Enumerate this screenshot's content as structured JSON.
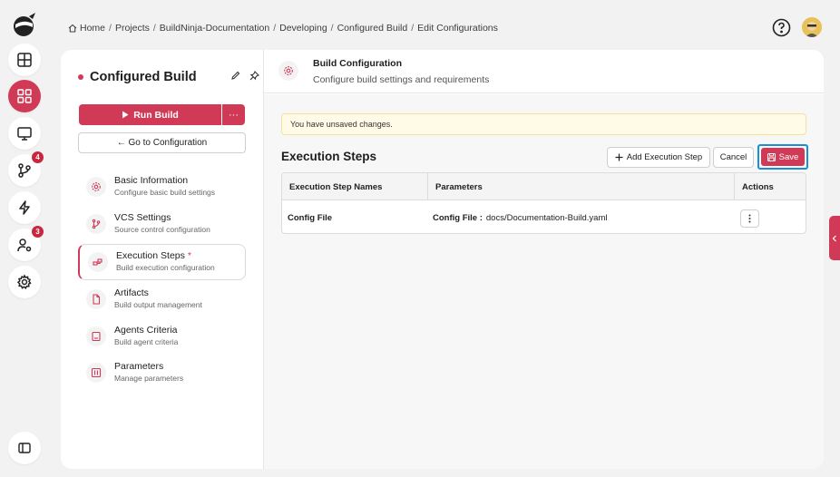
{
  "breadcrumb": [
    "Home",
    "Projects",
    "BuildNinja-Documentation",
    "Developing",
    "Configured Build",
    "Edit Configurations"
  ],
  "rail": {
    "badges": {
      "vcs": "4",
      "users": "3"
    }
  },
  "sidebar": {
    "title": "Configured Build",
    "run_build_label": "Run Build",
    "more_label": "···",
    "goto_label": "← Go to Configuration",
    "items": [
      {
        "label": "Basic Information",
        "sub": "Configure basic build settings",
        "icon": "gear-icon"
      },
      {
        "label": "VCS Settings",
        "sub": "Source control configuration",
        "icon": "branch-icon"
      },
      {
        "label": "Execution Steps",
        "sub": "Build execution configuration",
        "icon": "steps-icon",
        "modified": "*"
      },
      {
        "label": "Artifacts",
        "sub": "Build output management",
        "icon": "file-icon"
      },
      {
        "label": "Agents Criteria",
        "sub": "Build agent criteria",
        "icon": "monitor-icon"
      },
      {
        "label": "Parameters",
        "sub": "Manage parameters",
        "icon": "parameters-icon"
      }
    ]
  },
  "content": {
    "header_title": "Build Configuration",
    "header_sub": "Configure build settings and requirements",
    "alert": "You have unsaved changes.",
    "section_title": "Execution Steps",
    "add_step_label": "Add Execution Step",
    "cancel_label": "Cancel",
    "save_label": "Save",
    "table": {
      "headers": [
        "Execution Step Names",
        "Parameters",
        "Actions"
      ],
      "rows": [
        {
          "name": "Config File",
          "param_key": "Config File :",
          "param_value": "docs/Documentation-Build.yaml"
        }
      ]
    }
  },
  "colors": {
    "accent": "#d03a56",
    "focus": "#1a8fd6",
    "alert_bg": "#fffbe6"
  }
}
